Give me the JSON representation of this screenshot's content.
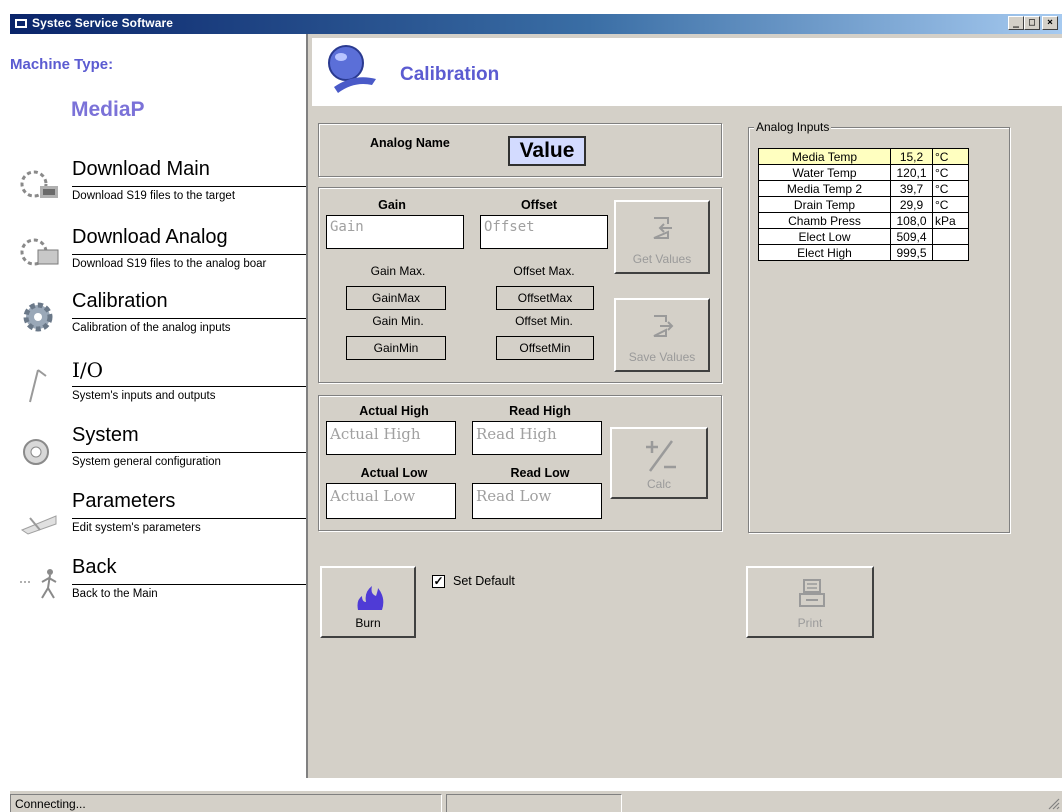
{
  "window": {
    "title": "Systec Service Software",
    "min": "_",
    "max": "□",
    "close": "×"
  },
  "sidebar": {
    "machine_type_label": "Machine Type:",
    "machine_type_value": "MediaP",
    "items": [
      {
        "title": "Download Main",
        "desc": "Download S19 files to the target",
        "icon": "download-icon"
      },
      {
        "title": "Download Analog",
        "desc": "Download S19 files to the analog boar",
        "icon": "download-analog-icon"
      },
      {
        "title": "Calibration",
        "desc": "Calibration of the analog inputs",
        "icon": "gear-icon"
      },
      {
        "title": "I/O",
        "desc": "System's inputs and outputs",
        "icon": "io-icon"
      },
      {
        "title": "System",
        "desc": "System general configuration",
        "icon": "disk-icon"
      },
      {
        "title": "Parameters",
        "desc": "Edit system's parameters",
        "icon": "parameters-icon"
      },
      {
        "title": "Back",
        "desc": "Back to the Main",
        "icon": "back-icon"
      }
    ]
  },
  "main": {
    "title": "Calibration",
    "analog_name_label": "Analog Name",
    "analog_value": "Value",
    "gain_group": {
      "gain_label": "Gain",
      "gain_placeholder": "Gain",
      "offset_label": "Offset",
      "offset_placeholder": "Offset",
      "gain_max_label": "Gain Max.",
      "gain_max_value": "GainMax",
      "offset_max_label": "Offset Max.",
      "offset_max_value": "OffsetMax",
      "gain_min_label": "Gain Min.",
      "gain_min_value": "GainMin",
      "offset_min_label": "Offset Min.",
      "offset_min_value": "OffsetMin",
      "get_values_label": "Get Values",
      "save_values_label": "Save Values"
    },
    "calc_group": {
      "actual_high_label": "Actual High",
      "actual_high_placeholder": "Actual High",
      "read_high_label": "Read High",
      "read_high_placeholder": "Read High",
      "actual_low_label": "Actual Low",
      "actual_low_placeholder": "Actual Low",
      "read_low_label": "Read Low",
      "read_low_placeholder": "Read Low",
      "calc_label": "Calc"
    },
    "burn_label": "Burn",
    "set_default_label": "Set Default",
    "set_default_checked": "✓",
    "print_label": "Print",
    "analog_inputs": {
      "legend": "Analog Inputs",
      "rows": [
        {
          "name": "Media Temp",
          "value": "15,2",
          "unit": "°C"
        },
        {
          "name": "Water Temp",
          "value": "120,1",
          "unit": "°C"
        },
        {
          "name": "Media Temp 2",
          "value": "39,7",
          "unit": "°C"
        },
        {
          "name": "Drain Temp",
          "value": "29,9",
          "unit": "°C"
        },
        {
          "name": "Chamb Press",
          "value": "108,0",
          "unit": "kPa"
        },
        {
          "name": "Elect Low",
          "value": "509,4",
          "unit": ""
        },
        {
          "name": "Elect High",
          "value": "999,5",
          "unit": ""
        }
      ]
    }
  },
  "status": {
    "text": "Connecting..."
  },
  "colors": {
    "accent": "#5b5bd1",
    "panel": "#d4d0c8",
    "highlight": "#ffffc0",
    "value_box": "#d3dbff"
  }
}
